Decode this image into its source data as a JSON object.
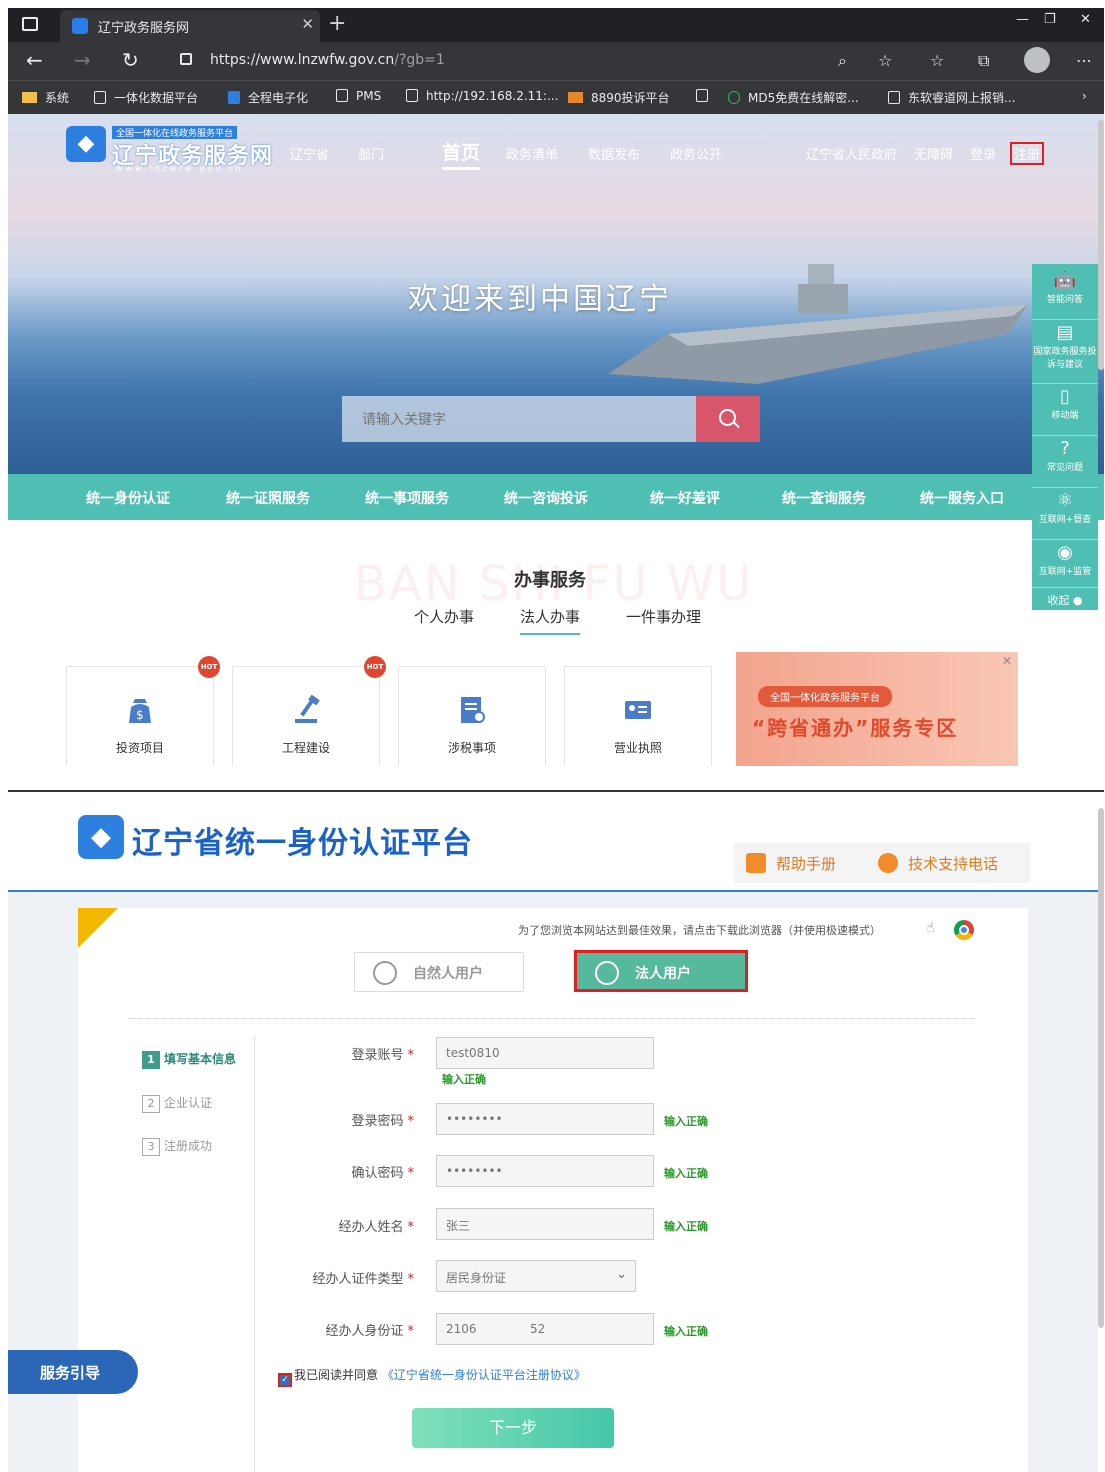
{
  "browser": {
    "tab_title": "辽宁政务服务网",
    "url_host": "https://www.lnzwfw.gov.cn",
    "url_path": "/?gb=1",
    "bookmarks": [
      "系统",
      "一体化数据平台",
      "全程电子化",
      "PMS",
      "http://192.168.2.11:...",
      "8890投诉平台",
      "MD5免费在线解密...",
      "东软睿道网上报销..."
    ]
  },
  "site": {
    "logo_small": "全国一体化在线政务服务平台",
    "logo_name": "辽宁政务服务网",
    "logo_url": "www.lnzwfw.gov.cn",
    "region": "辽宁省",
    "dept": "部门",
    "nav": [
      "首页",
      "政务清单",
      "数据发布",
      "政务公开"
    ],
    "top_links": [
      "辽宁省人民政府",
      "无障碍",
      "登录",
      "注册"
    ],
    "welcome": "欢迎来到中国辽宁",
    "search_placeholder": "请输入关键字",
    "green_menu": [
      "统一身份认证",
      "统一证照服务",
      "统一事项服务",
      "统一咨询投诉",
      "统一好差评",
      "统一查询服务",
      "统一服务入口"
    ],
    "side_panel": [
      "智能问答",
      "国家政务服务投诉与建议",
      "移动端",
      "常见问题",
      "互联网+督查",
      "互联网+监管",
      "收起"
    ],
    "watermark": "BAN SHI FU WU",
    "service_title": "办事服务",
    "service_tabs": [
      "个人办事",
      "法人办事",
      "一件事办理"
    ],
    "cards": [
      "投资项目",
      "工程建设",
      "涉税事项",
      "营业执照"
    ],
    "hot": "HOT",
    "banner_small": "全国一体化政务服务平台",
    "banner_big": "“跨省通办”服务专区"
  },
  "auth": {
    "title": "辽宁省统一身份认证平台",
    "help_manual": "帮助手册",
    "tech_support": "技术支持电话",
    "browser_tip": "为了您浏览本网站达到最佳效果，请点击下载此浏览器（并使用极速模式）",
    "tab_natural": "自然人用户",
    "tab_legal": "法人用户",
    "steps": [
      {
        "n": "1",
        "label": "填写基本信息"
      },
      {
        "n": "2",
        "label": "企业认证"
      },
      {
        "n": "3",
        "label": "注册成功"
      }
    ],
    "fields": {
      "account_label": "登录账号",
      "account_value": "test0810",
      "password_label": "登录密码",
      "password_value": "••••••••",
      "confirm_label": "确认密码",
      "confirm_value": "••••••••",
      "name_label": "经办人姓名",
      "name_value": "张三",
      "idtype_label": "经办人证件类型",
      "idtype_value": "居民身份证",
      "idno_label": "经办人身份证",
      "idno_value": "2106              52"
    },
    "ok_text": "输入正确",
    "agree_text": "我已阅读并同意",
    "agree_link": "《辽宁省统一身份认证平台注册协议》",
    "next": "下一步",
    "guide": "服务引导"
  }
}
